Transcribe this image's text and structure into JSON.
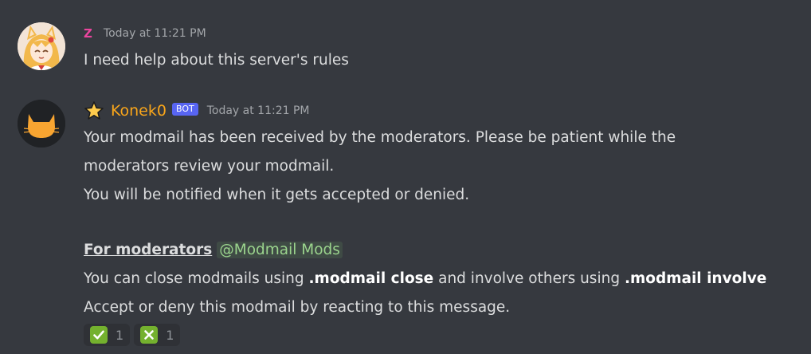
{
  "messages": [
    {
      "username": "Z",
      "timestamp": "Today at 11:21 PM",
      "text": "I need help about this server's rules",
      "avatar_icon": "fox-girl-avatar"
    },
    {
      "username": "Konek0",
      "bot_tag": "BOT",
      "timestamp": "Today at 11:21 PM",
      "avatar_icon": "cat-avatar",
      "prefix_icon": "star-icon",
      "lines": [
        "Your modmail has been received by the moderators. Please be patient while the",
        "moderators review your modmail.",
        "You will be notified when it gets accepted or denied."
      ],
      "mod_heading": "For moderators",
      "mention": "@Modmail Mods",
      "close_text_1": "You can close modmails using ",
      "close_cmd": ".modmail close",
      "close_text_2": " and involve others using ",
      "involve_cmd": ".modmail involve",
      "accept_line": "Accept or deny this modmail by reacting to this message.",
      "reactions": [
        {
          "emoji": "check-mark-icon",
          "count": "1"
        },
        {
          "emoji": "cross-mark-icon",
          "count": "1"
        }
      ]
    }
  ],
  "colors": {
    "background": "#36393f",
    "username_z": "#eb459e",
    "username_bot": "#faa61a",
    "bot_tag": "#5865f2",
    "mention_text": "#9bd48d",
    "reaction_emoji_bg": "#74b12e"
  }
}
